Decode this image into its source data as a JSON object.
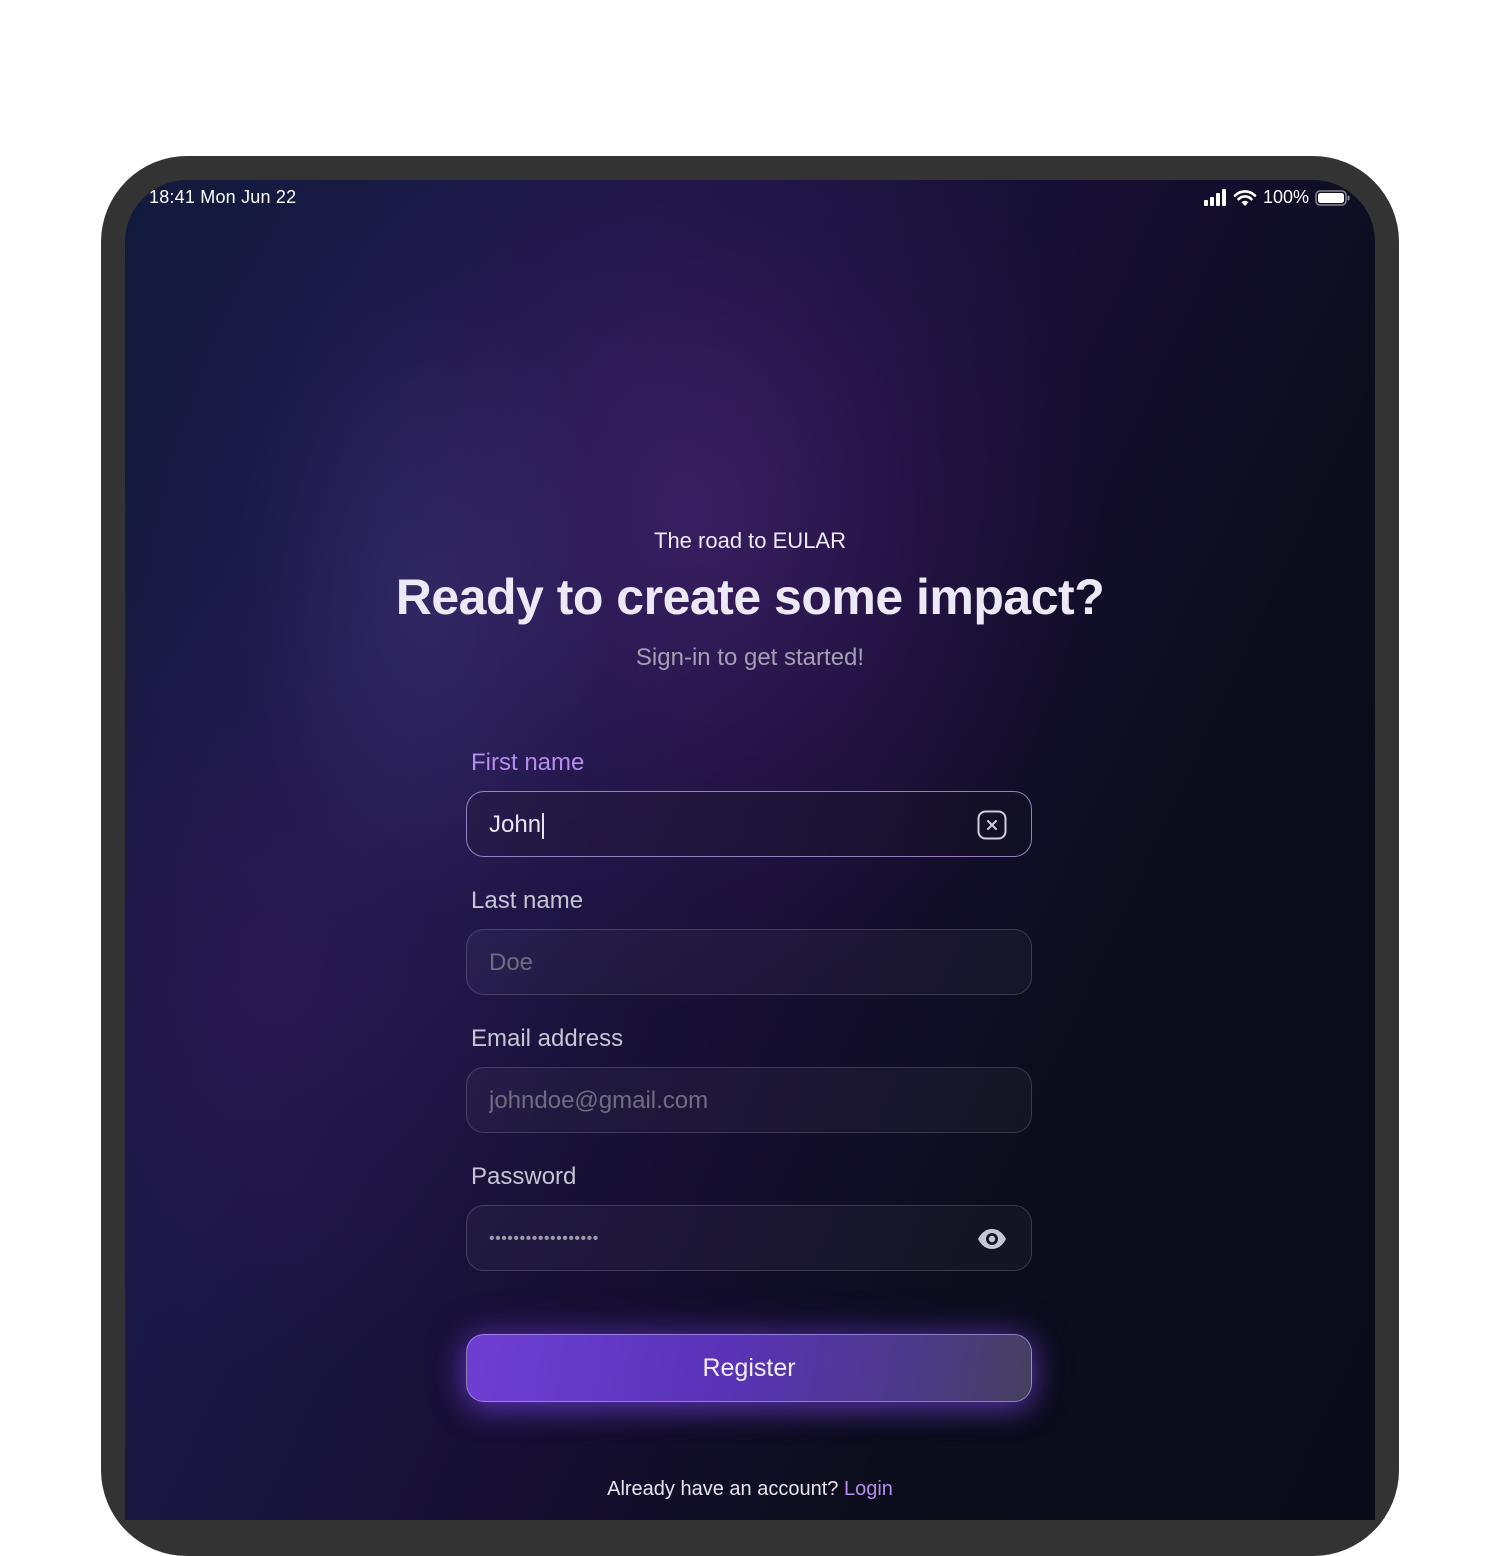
{
  "status_bar": {
    "time": "18:41",
    "date": "Mon Jun 22",
    "battery": "100%"
  },
  "header": {
    "eyebrow": "The road to EULAR",
    "title": "Ready to create some impact?",
    "subtitle": "Sign-in to get started!"
  },
  "form": {
    "first_name": {
      "label": "First name",
      "value": "John"
    },
    "last_name": {
      "label": "Last name",
      "placeholder": "Doe"
    },
    "email": {
      "label": "Email address",
      "placeholder": "johndoe@gmail.com"
    },
    "password": {
      "label": "Password",
      "value_masked": "••••••••••••••••••"
    },
    "submit_label": "Register"
  },
  "footer": {
    "prompt": "Already have an account?",
    "login_label": "Login"
  },
  "colors": {
    "accent": "#b58cf0",
    "button": "#6d3fd4",
    "background": "#0c0d1c"
  },
  "icons": {
    "clear": "clear-input-icon",
    "reveal": "eye-icon"
  }
}
